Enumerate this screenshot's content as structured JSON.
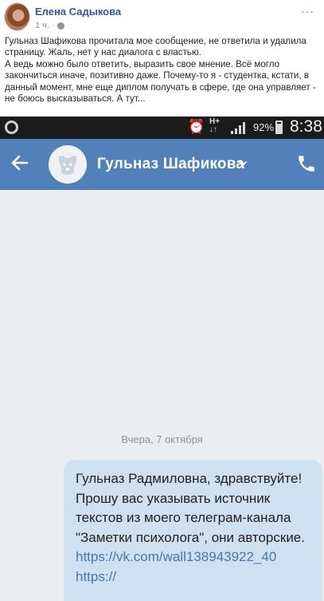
{
  "post": {
    "author": "Елена Садыкова",
    "time": "1 ч.",
    "more_label": "···",
    "paragraph1": "Гульназ Шафикова прочитала мое сообщение, не ответила и удалила страницу. Жаль, нет у нас диалога с властью.",
    "paragraph2": "А ведь можно было ответить, выразить свое мнение. Всё могло закончиться иначе, позитивно даже. Почему-то я - студентка, кстати, в данный момент, мне еще диплом получать в сфере, где она управляет - не боюсь высказываться. А тут..."
  },
  "statusbar": {
    "battery": "92%",
    "time": "8:38",
    "network_top": "H",
    "network_plus": "+",
    "network_bottom": "↓↑"
  },
  "chat": {
    "contact_name": "Гульназ Шафикова",
    "date_label": "Вчера, 7 октября",
    "message_text": "Гульназ Радмиловна, здравствуйте! Прошу вас указывать источник текстов из моего телеграм-канала \"Заметки психолога\", они авторские. ",
    "message_link": "https://vk.com/wall138943922_40 https://"
  },
  "colors": {
    "vk_header": "#5181b8",
    "bubble": "#cfe0f1",
    "fb_link": "#365899"
  }
}
